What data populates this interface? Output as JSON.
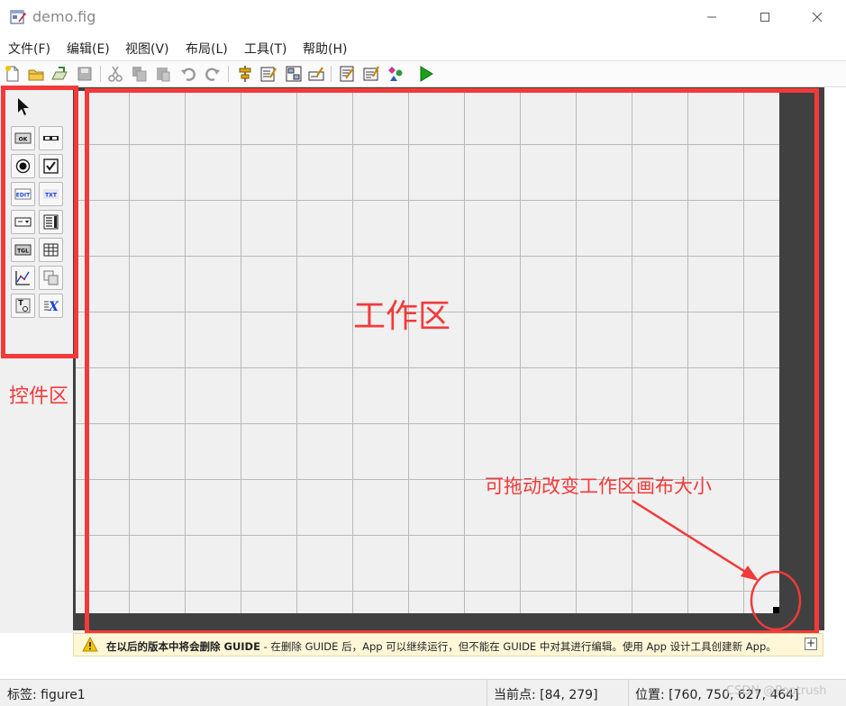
{
  "window": {
    "title": "demo.fig",
    "controls": [
      "minimize-icon",
      "maximize-icon",
      "close-icon"
    ]
  },
  "menu": [
    {
      "label": "文件(F)"
    },
    {
      "label": "编辑(E)"
    },
    {
      "label": "视图(V)"
    },
    {
      "label": "布局(L)"
    },
    {
      "label": "工具(T)"
    },
    {
      "label": "帮助(H)"
    }
  ],
  "toolbar": {
    "buttons": [
      "new-file-icon",
      "open-folder-icon",
      "open-icon",
      "save-icon",
      "cut-icon",
      "copy-icon",
      "paste-icon",
      "undo-icon",
      "redo-icon",
      "align-icon",
      "menu-editor-icon",
      "tab-order-icon",
      "toolbar-editor-icon",
      "editor-icon",
      "property-inspector-icon",
      "object-browser-icon",
      "run-icon"
    ]
  },
  "palette": {
    "tools": [
      {
        "name": "select-arrow-icon"
      },
      {
        "name": "push-button-icon",
        "glyph": "OK"
      },
      {
        "name": "slider-icon"
      },
      {
        "name": "radio-button-icon"
      },
      {
        "name": "checkbox-icon"
      },
      {
        "name": "edit-text-icon",
        "glyph": "EDIT"
      },
      {
        "name": "static-text-icon",
        "glyph": "TXT"
      },
      {
        "name": "popup-menu-icon"
      },
      {
        "name": "listbox-icon"
      },
      {
        "name": "toggle-button-icon",
        "glyph": "TGL"
      },
      {
        "name": "table-icon"
      },
      {
        "name": "axes-icon"
      },
      {
        "name": "panel-icon"
      },
      {
        "name": "button-group-icon",
        "glyph": "T"
      },
      {
        "name": "activex-icon",
        "glyph": "X"
      }
    ]
  },
  "annotations": {
    "workspace_label": "工作区",
    "palette_label": "控件区",
    "resize_hint": "可拖动改变工作区画布大小"
  },
  "warning": {
    "bold": "在以后的版本中将会删除 GUIDE",
    "rest": " - 在删除 GUIDE 后，App 可以继续运行，但不能在 GUIDE 中对其进行编辑。使用 App 设计工具创建新 App。",
    "expand": "+"
  },
  "status": {
    "tag": "标签: figure1",
    "current_point": "当前点:  [84, 279]",
    "position": "位置: [760, 750, 627, 464]"
  },
  "watermark": "CSDN @Poptrush",
  "colors": {
    "annotation_red": "#f23a3a",
    "canvas_border": "#404040",
    "grid_background": "#f0f0f0",
    "run_green": "#1aa01a"
  }
}
